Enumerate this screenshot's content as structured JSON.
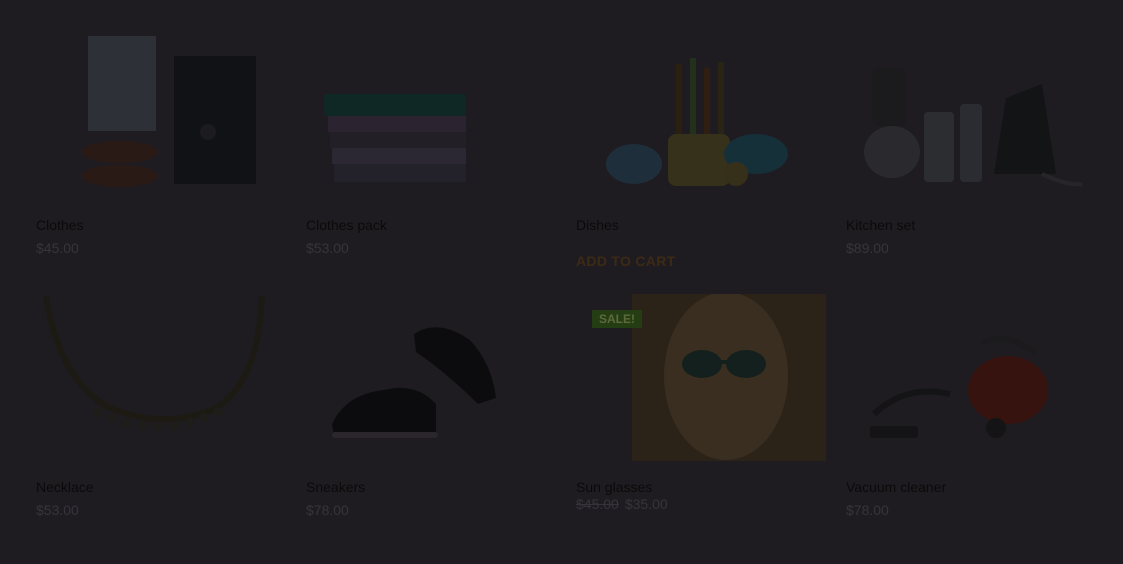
{
  "products": [
    {
      "title": "Clothes",
      "price": "$45.00",
      "image": "clothes-image"
    },
    {
      "title": "Clothes pack",
      "price": "$53.00",
      "image": "clothes-pack-image"
    },
    {
      "title": "Dishes",
      "price": "",
      "add_to_cart": "ADD TO CART",
      "image": "dishes-image"
    },
    {
      "title": "Kitchen set",
      "price": "$89.00",
      "image": "kitchen-set-image"
    },
    {
      "title": "Necklace",
      "price": "$53.00",
      "image": "necklace-image"
    },
    {
      "title": "Sneakers",
      "price": "$78.00",
      "image": "sneakers-image"
    },
    {
      "title": "Sun glasses",
      "old_price": "$45.00",
      "price": "$35.00",
      "badge": "SALE!",
      "image": "sunglasses-image"
    },
    {
      "title": "Vacuum cleaner",
      "price": "$78.00",
      "image": "vacuum-cleaner-image"
    }
  ],
  "colors": {
    "overlay": "#1f1c21",
    "title": "#0a0a0a",
    "price": "#38333a",
    "accent": "#3d2a14",
    "sale_badge": "#243d13"
  }
}
